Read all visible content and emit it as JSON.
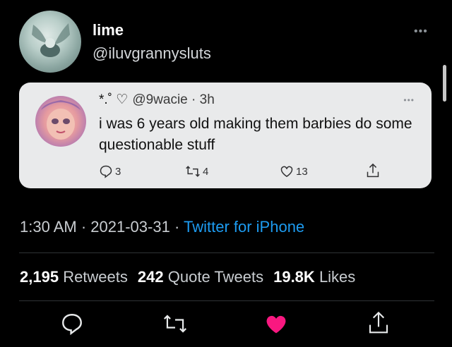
{
  "author": {
    "name": "lime",
    "handle": "@iluvgrannysluts",
    "avatar_icon": "avatar-image"
  },
  "more_label": "•••",
  "quoted": {
    "symbols": "*.˚ ♡",
    "handle_time": "@9wacie · 3h",
    "more_label": "•••",
    "text": "i was 6 years old making them barbies do some questionable stuff",
    "replies": "3",
    "retweets": "4",
    "likes": "13"
  },
  "meta": {
    "time": "1:30 AM",
    "sep1": " · ",
    "date": "2021-03-31",
    "sep2": " · ",
    "source": "Twitter for iPhone"
  },
  "stats": {
    "retweets_count": "2,195",
    "retweets_label": "Retweets",
    "quotes_count": "242",
    "quotes_label": "Quote Tweets",
    "likes_count": "19.8K",
    "likes_label": "Likes"
  },
  "colors": {
    "background": "#000000",
    "link": "#1d9bf0",
    "like_active": "#f91880",
    "quote_bg": "#e9eaeb"
  }
}
